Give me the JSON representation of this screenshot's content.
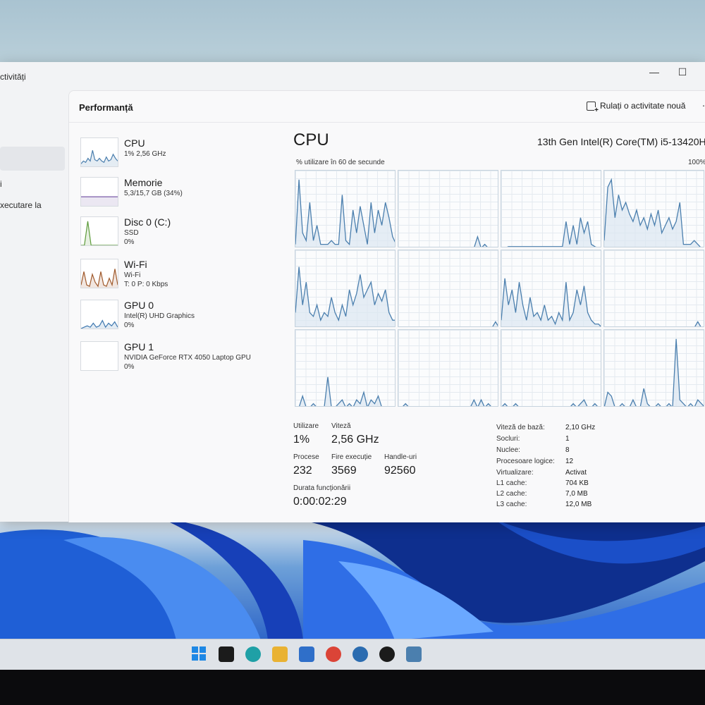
{
  "window": {
    "app_title": "ctivități",
    "controls": {
      "minimize": "—",
      "maximize": "☐"
    }
  },
  "nav": {
    "items": [
      {
        "label": "i"
      },
      {
        "label": "xecutare la"
      }
    ]
  },
  "panel": {
    "title": "Performanță",
    "run_task_label": "Rulați o activitate nouă",
    "more": "⋯"
  },
  "devices": [
    {
      "name": "CPU",
      "line1": "1% 2,56 GHz",
      "line2": "",
      "color": "#4b7fae",
      "icon": "cpu-sparkline",
      "spark": [
        0.1,
        0.2,
        0.15,
        0.3,
        0.2,
        0.6,
        0.25,
        0.2,
        0.3,
        0.2,
        0.15,
        0.35,
        0.2,
        0.25,
        0.45,
        0.3,
        0.2
      ]
    },
    {
      "name": "Memorie",
      "line1": "5,3/15,7 GB (34%)",
      "line2": "",
      "color": "#7a5ba8",
      "icon": "memory-sparkline",
      "spark": [
        0.34,
        0.34,
        0.34,
        0.34,
        0.34,
        0.34,
        0.34,
        0.34,
        0.34,
        0.34,
        0.34,
        0.34
      ]
    },
    {
      "name": "Disc 0 (C:)",
      "line1": "SSD",
      "line2": "0%",
      "color": "#5c9b3a",
      "icon": "disk-sparkline",
      "spark": [
        0,
        0,
        0.9,
        0,
        0,
        0,
        0,
        0,
        0,
        0,
        0,
        0
      ]
    },
    {
      "name": "Wi-Fi",
      "line1": "Wi-Fi",
      "line2": "T: 0 P: 0 Kbps",
      "color": "#a05a2c",
      "icon": "wifi-sparkline",
      "spark": [
        0.1,
        0.6,
        0.1,
        0.05,
        0.5,
        0.2,
        0.05,
        0.6,
        0.1,
        0.05,
        0.35,
        0.1,
        0.7,
        0.1
      ]
    },
    {
      "name": "GPU 0",
      "line1": "Intel(R) UHD Graphics",
      "line2": "0%",
      "color": "#3f78b0",
      "icon": "gpu0-sparkline",
      "spark": [
        0,
        0.05,
        0.1,
        0.05,
        0.2,
        0.05,
        0.1,
        0.3,
        0.05,
        0.2,
        0.1,
        0.25,
        0.05
      ]
    },
    {
      "name": "GPU 1",
      "line1": "NVIDIA GeForce RTX 4050 Laptop GPU",
      "line2": "0%",
      "color": "#3f78b0",
      "icon": "gpu1-sparkline",
      "spark": []
    }
  ],
  "detail": {
    "title": "CPU",
    "model": "13th Gen Intel(R) Core(TM) i5-13420H",
    "util_caption": "% utilizare în 60 de secunde",
    "pct_max": "100%",
    "core_series": [
      [
        0.05,
        0.9,
        0.2,
        0.1,
        0.6,
        0.1,
        0.3,
        0.05,
        0.05,
        0.05,
        0.1,
        0.05,
        0.05,
        0.7,
        0.1,
        0.05,
        0.5,
        0.2,
        0.55,
        0.3,
        0.05,
        0.6,
        0.2,
        0.5,
        0.3,
        0.6,
        0.4,
        0.15,
        0.05
      ],
      [
        0,
        0,
        0,
        0,
        0,
        0,
        0,
        0,
        0,
        0,
        0,
        0,
        0,
        0,
        0,
        0,
        0,
        0,
        0,
        0,
        0,
        0,
        0.15,
        0,
        0.05,
        0,
        0,
        0,
        0
      ],
      [
        0,
        0,
        0.02,
        0.02,
        0.02,
        0.02,
        0.02,
        0.02,
        0.02,
        0.02,
        0.02,
        0.02,
        0.02,
        0.02,
        0.02,
        0.02,
        0.02,
        0.02,
        0.35,
        0.05,
        0.3,
        0.05,
        0.4,
        0.2,
        0.35,
        0.05,
        0.02,
        0,
        0
      ],
      [
        0.1,
        0.8,
        0.9,
        0.4,
        0.7,
        0.5,
        0.6,
        0.45,
        0.35,
        0.5,
        0.3,
        0.4,
        0.25,
        0.45,
        0.3,
        0.5,
        0.2,
        0.3,
        0.4,
        0.25,
        0.35,
        0.6,
        0.05,
        0.05,
        0.05,
        0.1,
        0.05,
        0,
        0
      ],
      [
        0.2,
        0.8,
        0.3,
        0.6,
        0.2,
        0.15,
        0.3,
        0.1,
        0.2,
        0.15,
        0.4,
        0.2,
        0.1,
        0.3,
        0.15,
        0.5,
        0.3,
        0.45,
        0.7,
        0.4,
        0.5,
        0.6,
        0.3,
        0.45,
        0.35,
        0.5,
        0.2,
        0.1,
        0.1
      ],
      [
        0,
        0,
        0,
        0,
        0,
        0,
        0,
        0,
        0,
        0,
        0,
        0,
        0,
        0,
        0,
        0,
        0,
        0,
        0,
        0,
        0,
        0,
        0,
        0,
        0,
        0,
        0,
        0.08,
        0
      ],
      [
        0.1,
        0.65,
        0.3,
        0.5,
        0.2,
        0.6,
        0.3,
        0.1,
        0.4,
        0.15,
        0.2,
        0.1,
        0.3,
        0.1,
        0.15,
        0.05,
        0.2,
        0.1,
        0.6,
        0.1,
        0.2,
        0.5,
        0.3,
        0.55,
        0.2,
        0.1,
        0.05,
        0.05,
        0
      ],
      [
        0,
        0,
        0,
        0,
        0,
        0,
        0,
        0,
        0,
        0,
        0,
        0,
        0,
        0,
        0,
        0,
        0,
        0,
        0,
        0,
        0,
        0,
        0,
        0,
        0,
        0,
        0.08,
        0,
        0
      ],
      [
        0,
        0,
        0.15,
        0,
        0,
        0.05,
        0,
        0,
        0,
        0.4,
        0,
        0,
        0.05,
        0.1,
        0,
        0.05,
        0,
        0.1,
        0.05,
        0.2,
        0,
        0.1,
        0.05,
        0.15,
        0,
        0,
        0,
        0,
        0
      ],
      [
        0,
        0,
        0.05,
        0,
        0,
        0,
        0,
        0,
        0,
        0,
        0,
        0,
        0,
        0,
        0,
        0,
        0,
        0,
        0,
        0,
        0,
        0.1,
        0,
        0.1,
        0,
        0.05,
        0,
        0,
        0
      ],
      [
        0,
        0.05,
        0,
        0,
        0.05,
        0,
        0,
        0,
        0,
        0,
        0,
        0,
        0,
        0,
        0,
        0,
        0,
        0,
        0,
        0,
        0.05,
        0,
        0.05,
        0.1,
        0,
        0,
        0.05,
        0,
        0
      ],
      [
        0,
        0.2,
        0.15,
        0,
        0,
        0.05,
        0,
        0,
        0.1,
        0,
        0,
        0.25,
        0.05,
        0,
        0,
        0.05,
        0,
        0,
        0.05,
        0,
        0.9,
        0.1,
        0.05,
        0,
        0.05,
        0,
        0.1,
        0.05,
        0
      ]
    ],
    "stats": {
      "util_label": "Utilizare",
      "util_value": "1%",
      "speed_label": "Viteză",
      "speed_value": "2,56 GHz",
      "proc_label": "Procese",
      "proc_value": "232",
      "threads_label": "Fire execuție",
      "threads_value": "3569",
      "handles_label": "Handle-uri",
      "handles_value": "92560",
      "uptime_label": "Durata funcționării",
      "uptime_value": "0:00:02:29"
    },
    "specs": [
      {
        "k": "Viteză de bază:",
        "v": "2,10 GHz"
      },
      {
        "k": "Socluri:",
        "v": "1"
      },
      {
        "k": "Nuclee:",
        "v": "8"
      },
      {
        "k": "Procesoare logice:",
        "v": "12"
      },
      {
        "k": "Virtualizare:",
        "v": "Activat"
      },
      {
        "k": "L1 cache:",
        "v": "704 KB"
      },
      {
        "k": "L2 cache:",
        "v": "7,0 MB"
      },
      {
        "k": "L3 cache:",
        "v": "12,0 MB"
      }
    ],
    "line_color": "#4b7fae",
    "fill_color": "#dbe7f1"
  },
  "taskbar": {
    "icons": [
      {
        "name": "start-icon",
        "color": "#1e88e5"
      },
      {
        "name": "terminal-icon",
        "color": "#1b1b1b"
      },
      {
        "name": "edge-icon",
        "color": "#1fa0a6"
      },
      {
        "name": "file-explorer-icon",
        "color": "#e9b233"
      },
      {
        "name": "store-icon",
        "color": "#2f6fc9"
      },
      {
        "name": "chrome-icon",
        "color": "#db4437"
      },
      {
        "name": "app-icon",
        "color": "#2b6cb0"
      },
      {
        "name": "whatsapp-icon",
        "color": "#1b1b1b"
      },
      {
        "name": "task-manager-icon",
        "color": "#4b7fae"
      }
    ]
  }
}
